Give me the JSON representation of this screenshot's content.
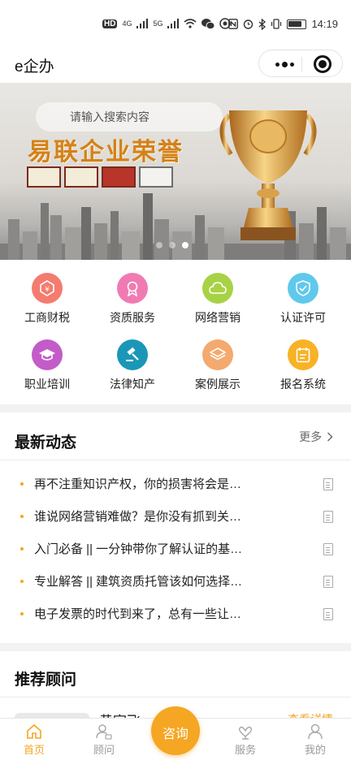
{
  "status_bar": {
    "hd_badge": "HD",
    "network1": "4G",
    "network2": "5G",
    "time": "14:19"
  },
  "nav": {
    "title": "e企办"
  },
  "banner": {
    "search_placeholder": "请输入搜索内容",
    "headline": "易联企业荣誉",
    "plaque_text": "",
    "active_slide": 3,
    "slide_count": 3
  },
  "categories": [
    {
      "label": "工商财税",
      "icon": "tax-icon",
      "color": "#f47b6f"
    },
    {
      "label": "资质服务",
      "icon": "award-ribbon-icon",
      "color": "#f07bb2"
    },
    {
      "label": "网络营销",
      "icon": "cloud-icon",
      "color": "#a8d246"
    },
    {
      "label": "认证许可",
      "icon": "shield-check-icon",
      "color": "#5fc9ec"
    },
    {
      "label": "职业培训",
      "icon": "graduation-cap-icon",
      "color": "#c35bc8"
    },
    {
      "label": "法律知产",
      "icon": "gavel-icon",
      "color": "#1a97b7"
    },
    {
      "label": "案例展示",
      "icon": "layers-icon",
      "color": "#f4a96e"
    },
    {
      "label": "报名系统",
      "icon": "form-icon",
      "color": "#f8b226"
    }
  ],
  "news": {
    "title": "最新动态",
    "more_label": "更多",
    "items": [
      "再不注重知识产权，你的损害将会是…",
      "谁说网络营销难做？是你没有抓到关…",
      "入门必备 || 一分钟带你了解认证的基…",
      "专业解答 || 建筑资质托管该如何选择…",
      "电子发票的时代到来了，总有一些让…"
    ]
  },
  "advisors": {
    "title": "推荐顾问",
    "first_name": "黄宇飞",
    "first_link": "查看详情"
  },
  "tabbar": {
    "home": "首页",
    "advisor": "顾问",
    "consult": "咨询",
    "service": "服务",
    "mine": "我的"
  },
  "colors": {
    "accent": "#f5a623",
    "banner_title": "#d4811a"
  }
}
